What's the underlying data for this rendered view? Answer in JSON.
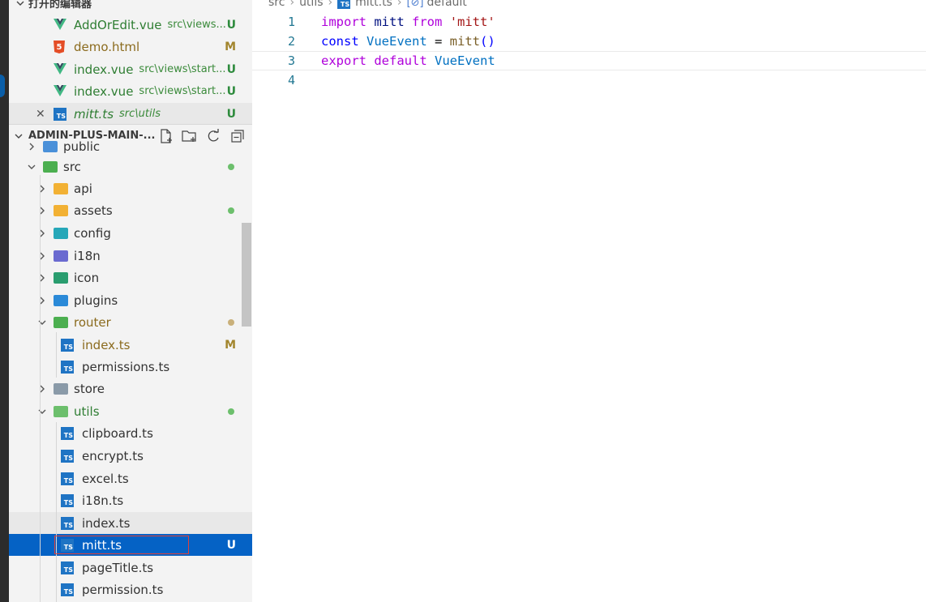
{
  "sidebar": {
    "open_editors_title": "打开的编辑器",
    "open_editors": [
      {
        "name": "AddOrEdit.vue",
        "desc": "src\\views...",
        "status": "U",
        "icon": "vue-icon"
      },
      {
        "name": "demo.html",
        "desc": "",
        "status": "M",
        "icon": "html5-icon"
      },
      {
        "name": "index.vue",
        "desc": "src\\views\\start...",
        "status": "U",
        "icon": "vue-icon"
      },
      {
        "name": "index.vue",
        "desc": "src\\views\\start...",
        "status": "U",
        "icon": "vue-icon"
      },
      {
        "name": "mitt.ts",
        "desc": "src\\utils",
        "status": "U",
        "icon": "ts-icon",
        "active": true
      }
    ],
    "workspace_title": "ADMIN-PLUS-MAIN-...",
    "tree": [
      {
        "name": "public",
        "type": "folder",
        "color": "#4a90d9"
      },
      {
        "name": "src",
        "type": "folder",
        "expanded": true,
        "dot": "#6cbf6c",
        "color": "#4caf50"
      },
      {
        "name": "api",
        "type": "folder",
        "color": "#f2b134"
      },
      {
        "name": "assets",
        "type": "folder",
        "dot": "#6cbf6c",
        "color": "#f2b134"
      },
      {
        "name": "config",
        "type": "folder",
        "color": "#26a7b8"
      },
      {
        "name": "i18n",
        "type": "folder",
        "color": "#6a6ad0"
      },
      {
        "name": "icon",
        "type": "folder",
        "color": "#2a9d6f"
      },
      {
        "name": "plugins",
        "type": "folder",
        "color": "#2b8ad8"
      },
      {
        "name": "router",
        "type": "folder",
        "expanded": true,
        "dot": "#c9b07a",
        "color": "#4caf50",
        "modified": true
      },
      {
        "name": "index.ts",
        "type": "ts",
        "status": "M",
        "modified": true
      },
      {
        "name": "permissions.ts",
        "type": "ts"
      },
      {
        "name": "store",
        "type": "folder",
        "color": "#8a9aa8"
      },
      {
        "name": "utils",
        "type": "folder",
        "expanded": true,
        "dot": "#6cbf6c",
        "color": "#6cbf6c",
        "untracked": true
      },
      {
        "name": "clipboard.ts",
        "type": "ts"
      },
      {
        "name": "encrypt.ts",
        "type": "ts"
      },
      {
        "name": "excel.ts",
        "type": "ts"
      },
      {
        "name": "i18n.ts",
        "type": "ts"
      },
      {
        "name": "index.ts",
        "type": "ts"
      },
      {
        "name": "mitt.ts",
        "type": "ts",
        "status": "U",
        "selected": true
      },
      {
        "name": "pageTitle.ts",
        "type": "ts"
      },
      {
        "name": "permission.ts",
        "type": "ts"
      }
    ]
  },
  "editor": {
    "breadcrumb": [
      "src",
      "utils",
      "mitt.ts",
      "default"
    ],
    "lines": [
      {
        "num": "1",
        "tokens": [
          [
            "kw",
            "import"
          ],
          [
            "punc",
            " "
          ],
          [
            "var",
            "mitt"
          ],
          [
            "punc",
            " "
          ],
          [
            "kw",
            "from"
          ],
          [
            "punc",
            " "
          ],
          [
            "str",
            "'mitt'"
          ]
        ]
      },
      {
        "num": "2",
        "tokens": [
          [
            "kw2",
            "const"
          ],
          [
            "punc",
            " "
          ],
          [
            "cls",
            "VueEvent"
          ],
          [
            "punc",
            " = "
          ],
          [
            "fn",
            "mitt"
          ],
          [
            "kw2",
            "()"
          ]
        ]
      },
      {
        "num": "3",
        "tokens": [
          [
            "kw",
            "export"
          ],
          [
            "punc",
            " "
          ],
          [
            "kw",
            "default"
          ],
          [
            "punc",
            " "
          ],
          [
            "cls",
            "VueEvent"
          ]
        ]
      },
      {
        "num": "4",
        "tokens": []
      }
    ]
  }
}
